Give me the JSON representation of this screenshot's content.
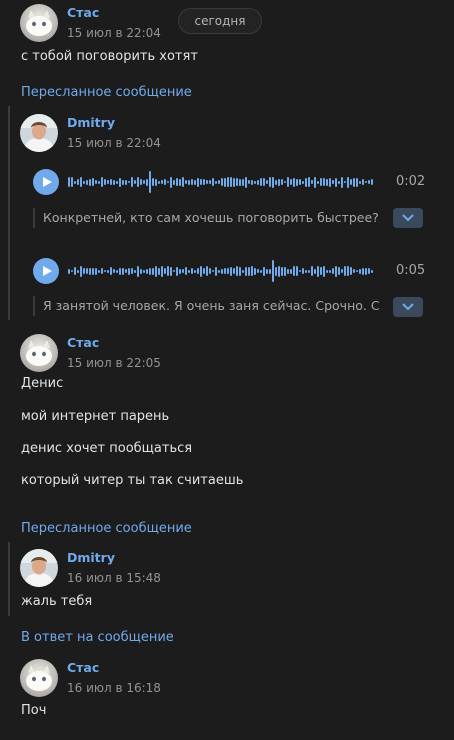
{
  "date_divider": "сегодня",
  "messages": [
    {
      "author": "Стас",
      "time": "15 июл в 22:04",
      "texts": [
        "с тобой поговорить хотят"
      ]
    },
    {
      "author": "Стас",
      "time": "15 июл в 22:05",
      "texts": [
        "Денис",
        "мой интернет парень",
        "денис хочет пообщаться",
        "который читер ты так считаешь"
      ]
    },
    {
      "author": "Стас",
      "time": "16 июл в 16:18",
      "texts": [
        "Поч"
      ]
    }
  ],
  "forwarded": [
    {
      "label": "Пересланное сообщение",
      "author": "Dmitry",
      "time": "15 июл в 22:04",
      "voice": [
        {
          "duration": "0:02",
          "transcript": "Конкретней, кто сам хочешь поговорить быстрее?"
        },
        {
          "duration": "0:05",
          "transcript": "Я занятой человек. Я очень заня сейчас. Срочно. С"
        }
      ]
    },
    {
      "label": "Пересланное сообщение",
      "author": "Dmitry",
      "time": "16 июл в 15:48",
      "texts": [
        "жаль тебя"
      ]
    }
  ],
  "reply_label": "В ответ на сообщение",
  "icons": {
    "play": "play-icon",
    "expand": "chevron-down-icon",
    "avatar_stas": "cat-avatar",
    "avatar_dmitry": "person-avatar"
  },
  "colors": {
    "accent": "#71aaeb",
    "background": "#1c1c1d",
    "text": "#e1e3e6",
    "muted": "#939393"
  }
}
